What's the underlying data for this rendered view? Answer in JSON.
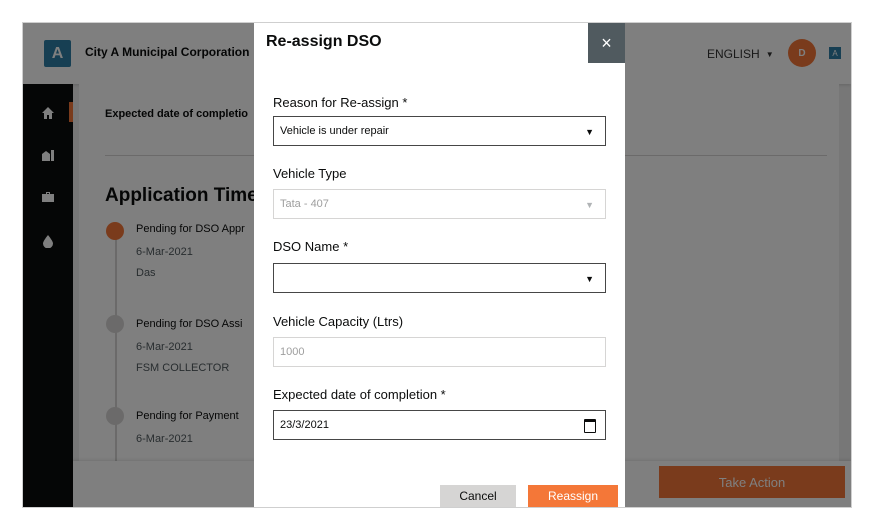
{
  "app": {
    "logo_letter": "A",
    "city_name": "City A Municipal Corporation",
    "language": "ENGLISH",
    "avatar_initial": "D",
    "badge_letter": "A"
  },
  "sidebar": {
    "items": [
      {
        "icon": "home-icon"
      },
      {
        "icon": "city-icon"
      },
      {
        "icon": "briefcase-icon"
      },
      {
        "icon": "water-drop-icon"
      }
    ]
  },
  "content": {
    "expected_date_label": "Expected date of completio",
    "timeline_title": "Application Timeli",
    "timeline": [
      {
        "title": "Pending for DSO Appr",
        "date": "6-Mar-2021",
        "by": "Das",
        "active": true
      },
      {
        "title": "Pending for DSO Assi",
        "date": "6-Mar-2021",
        "by": "FSM COLLECTOR",
        "active": false
      },
      {
        "title": "Pending for Payment",
        "date": "6-Mar-2021",
        "by": "",
        "active": false
      }
    ],
    "take_action_label": "Take Action"
  },
  "modal": {
    "title": "Re-assign DSO",
    "close_symbol": "×",
    "reason_label": "Reason for Re-assign *",
    "reason_value": "Vehicle is under repair",
    "vehicle_type_label": "Vehicle Type",
    "vehicle_type_value": "Tata - 407",
    "dso_name_label": "DSO Name *",
    "dso_name_value": "",
    "capacity_label": "Vehicle Capacity (Ltrs)",
    "capacity_value": "1000",
    "expected_label": "Expected date of completion *",
    "expected_value": "23/3/2021",
    "cancel_label": "Cancel",
    "reassign_label": "Reassign"
  },
  "colors": {
    "accent": "#f47738",
    "brand": "#2e7fa6",
    "sidebar": "#0b0c0c"
  }
}
